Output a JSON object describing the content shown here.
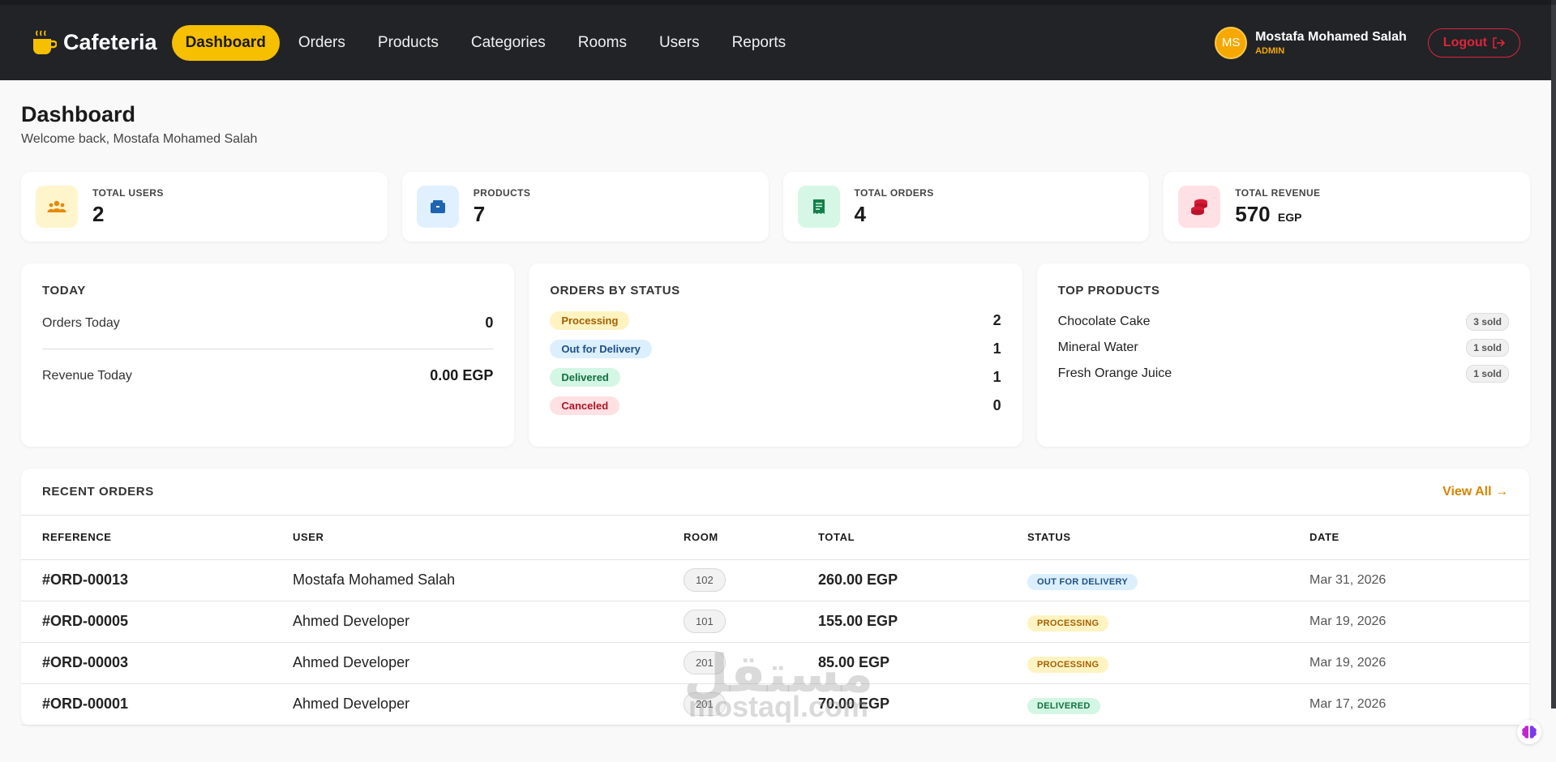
{
  "brand": {
    "name": "Cafeteria",
    "icon": "coffee-cup-icon"
  },
  "nav": {
    "items": [
      {
        "label": "Dashboard",
        "active": true
      },
      {
        "label": "Orders"
      },
      {
        "label": "Products"
      },
      {
        "label": "Categories"
      },
      {
        "label": "Rooms"
      },
      {
        "label": "Users"
      },
      {
        "label": "Reports"
      }
    ]
  },
  "user": {
    "initials": "MS",
    "name": "Mostafa Mohamed Salah",
    "role": "ADMIN",
    "logout_label": "Logout"
  },
  "page": {
    "title": "Dashboard",
    "subtitle": "Welcome back, Mostafa Mohamed Salah"
  },
  "stats": [
    {
      "label": "TOTAL USERS",
      "value": "2",
      "unit": "",
      "icon": "users-icon",
      "bg": "#fff5cc",
      "color": "#e8890c"
    },
    {
      "label": "PRODUCTS",
      "value": "7",
      "unit": "",
      "icon": "box-icon",
      "bg": "#e0f0ff",
      "color": "#1f64b0"
    },
    {
      "label": "TOTAL ORDERS",
      "value": "4",
      "unit": "",
      "icon": "receipt-icon",
      "bg": "#d6f7e6",
      "color": "#128048"
    },
    {
      "label": "TOTAL REVENUE",
      "value": "570",
      "unit": "EGP",
      "icon": "coins-icon",
      "bg": "#ffe1e5",
      "color": "#d81b35"
    }
  ],
  "today": {
    "title": "TODAY",
    "orders_label": "Orders Today",
    "orders_value": "0",
    "revenue_label": "Revenue Today",
    "revenue_value": "0.00 EGP"
  },
  "orders_by_status": {
    "title": "ORDERS BY STATUS",
    "items": [
      {
        "label": "Processing",
        "count": "2",
        "kind": "processing"
      },
      {
        "label": "Out for Delivery",
        "count": "1",
        "kind": "delivery"
      },
      {
        "label": "Delivered",
        "count": "1",
        "kind": "delivered"
      },
      {
        "label": "Canceled",
        "count": "0",
        "kind": "canceled"
      }
    ]
  },
  "top_products": {
    "title": "TOP PRODUCTS",
    "items": [
      {
        "name": "Chocolate Cake",
        "sold": "3 sold"
      },
      {
        "name": "Mineral Water",
        "sold": "1 sold"
      },
      {
        "name": "Fresh Orange Juice",
        "sold": "1 sold"
      }
    ]
  },
  "recent_orders": {
    "title": "RECENT ORDERS",
    "view_all": "View All →",
    "columns": [
      "REFERENCE",
      "USER",
      "ROOM",
      "TOTAL",
      "STATUS",
      "DATE"
    ],
    "rows": [
      {
        "ref": "#ORD-00013",
        "user": "Mostafa Mohamed Salah",
        "room": "102",
        "total": "260.00 EGP",
        "status": "OUT FOR DELIVERY",
        "kind": "delivery",
        "date": "Mar 31, 2026"
      },
      {
        "ref": "#ORD-00005",
        "user": "Ahmed Developer",
        "room": "101",
        "total": "155.00 EGP",
        "status": "PROCESSING",
        "kind": "processing",
        "date": "Mar 19, 2026"
      },
      {
        "ref": "#ORD-00003",
        "user": "Ahmed Developer",
        "room": "201",
        "total": "85.00 EGP",
        "status": "PROCESSING",
        "kind": "processing",
        "date": "Mar 19, 2026"
      },
      {
        "ref": "#ORD-00001",
        "user": "Ahmed Developer",
        "room": "201",
        "total": "70.00 EGP",
        "status": "DELIVERED",
        "kind": "delivered",
        "date": "Mar 17, 2026"
      }
    ]
  },
  "watermark": {
    "arabic": "مستقل",
    "latin": "mostaql.com"
  }
}
